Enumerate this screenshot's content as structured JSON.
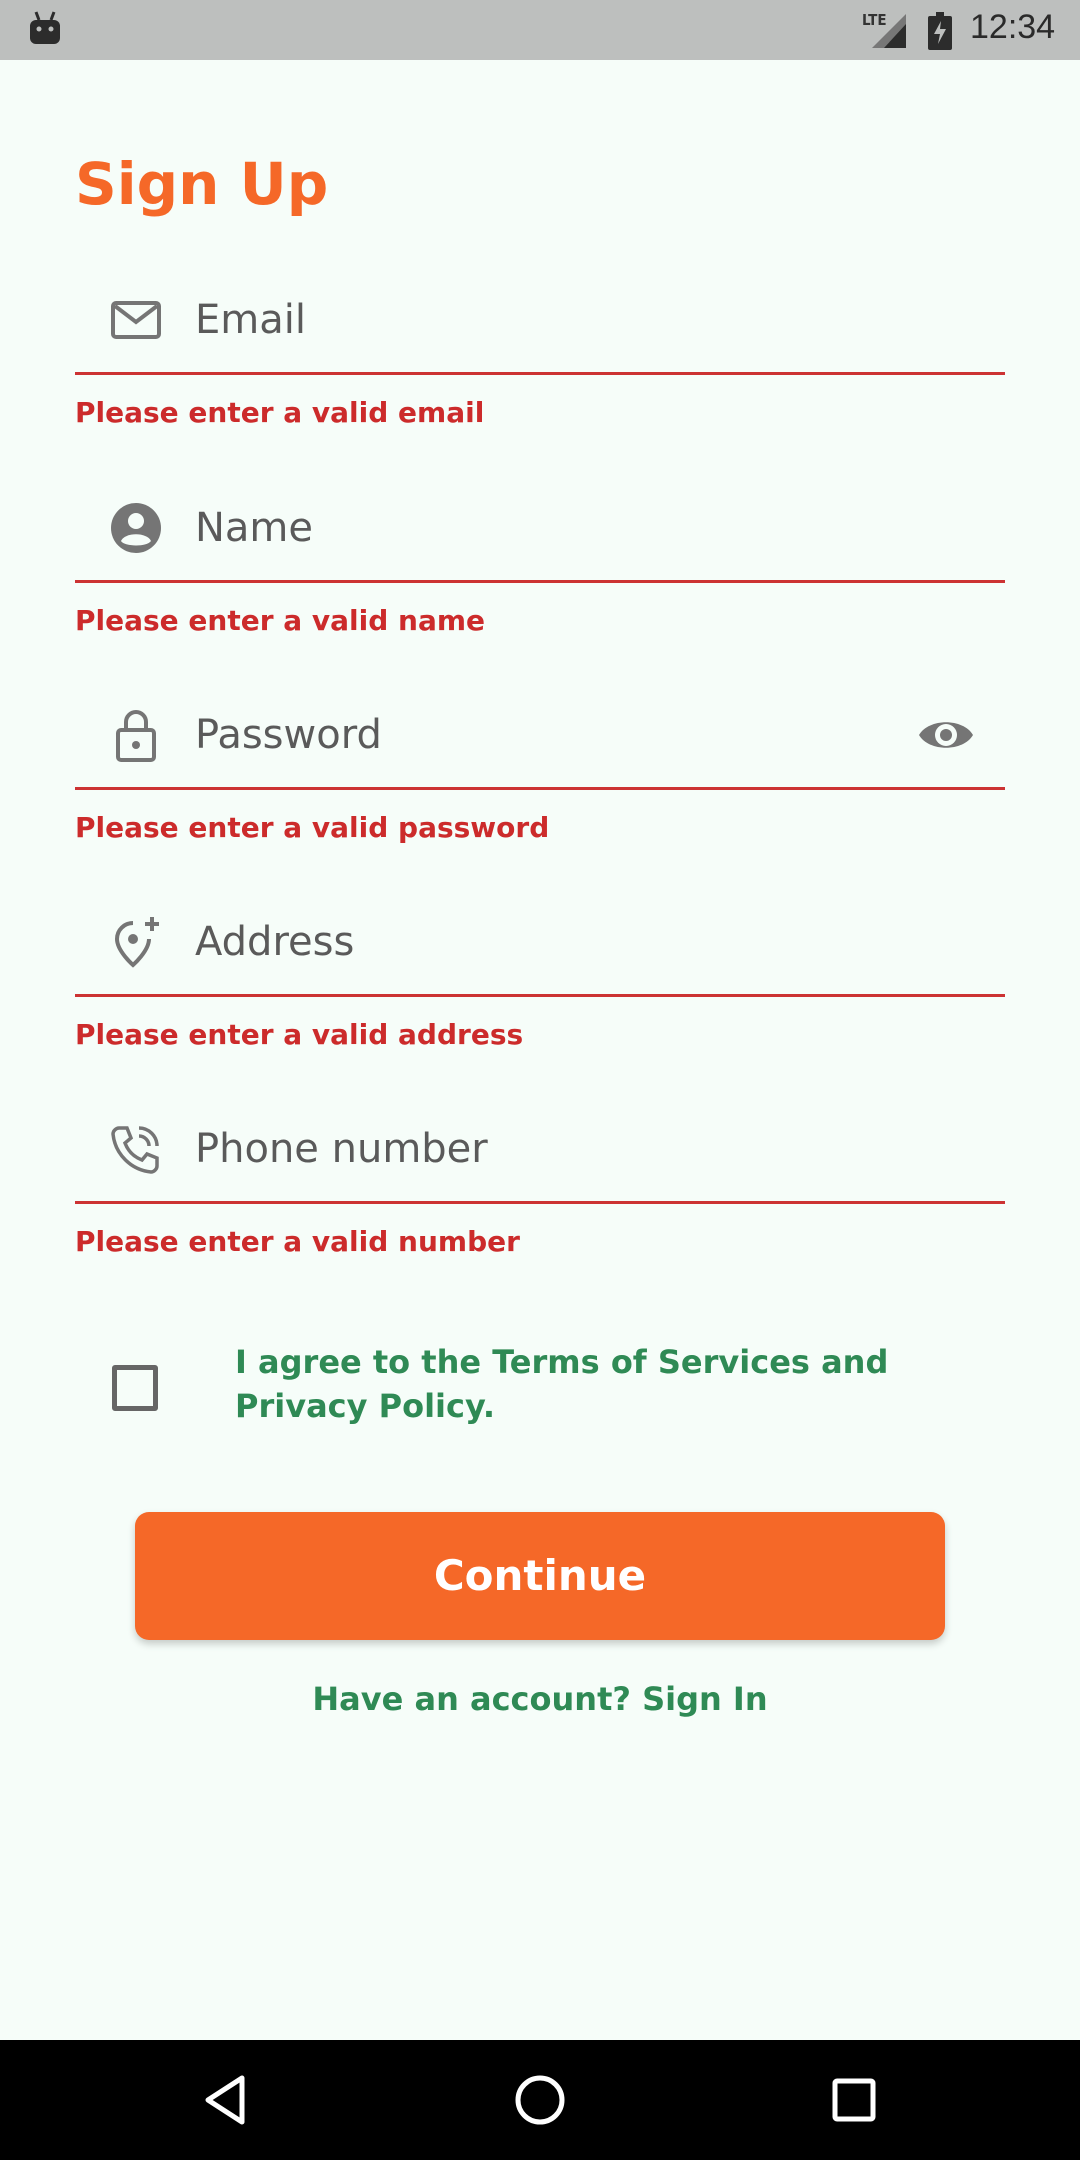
{
  "status_bar": {
    "network": "LTE",
    "time": "12:34"
  },
  "title": "Sign Up",
  "fields": [
    {
      "placeholder": "Email",
      "error": "Please enter a valid email",
      "icon": "mail-icon"
    },
    {
      "placeholder": "Name",
      "error": "Please enter a valid name",
      "icon": "account-icon"
    },
    {
      "placeholder": "Password",
      "error": "Please enter a valid password",
      "icon": "lock-icon"
    },
    {
      "placeholder": "Address",
      "error": "Please enter a valid address",
      "icon": "add-location-icon"
    },
    {
      "placeholder": "Phone number",
      "error": "Please enter a valid number",
      "icon": "phone-icon"
    }
  ],
  "terms": {
    "checked": false,
    "label": "I agree to the Terms of Services and Privacy Policy."
  },
  "continue_label": "Continue",
  "signin_label": "Have an account? Sign In",
  "colors": {
    "accent": "#f56828",
    "error": "#cc2b2b",
    "link": "#2f8a55",
    "background": "#f6fdf9"
  }
}
